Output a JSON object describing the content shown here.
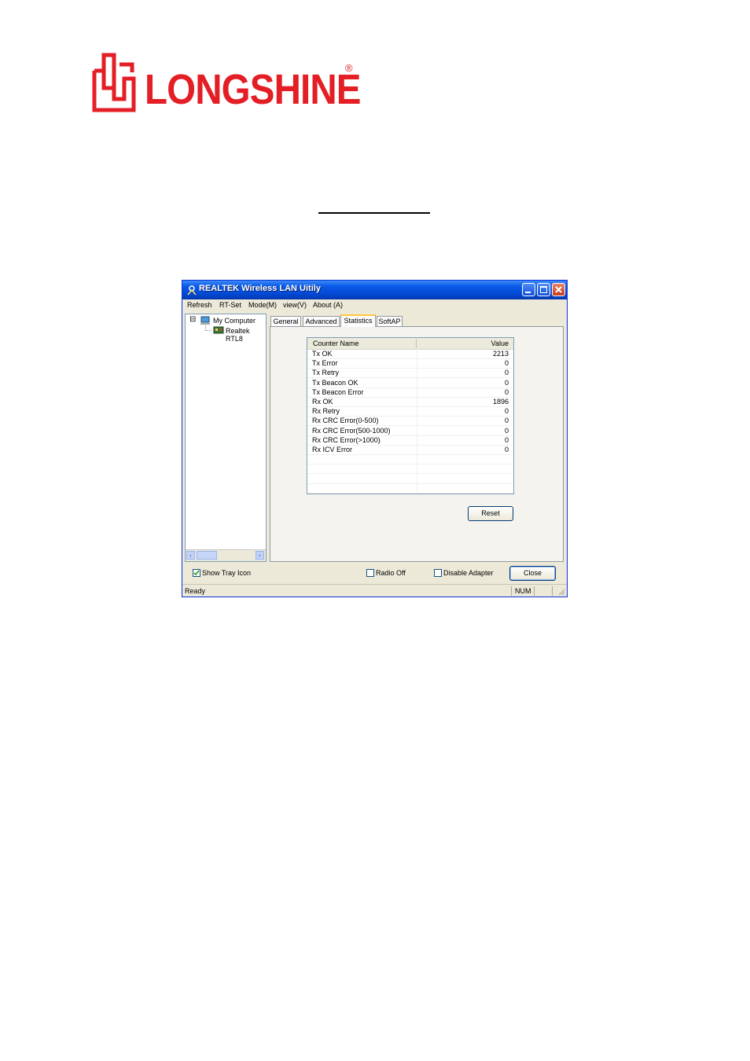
{
  "logo": {
    "brand": "LONGSHINE",
    "registered": "®"
  },
  "window": {
    "title": "REALTEK Wireless LAN Uitily"
  },
  "menu": [
    "Refresh",
    "RT-Set",
    "Mode(M)",
    "view(V)",
    "About (A)"
  ],
  "tree": {
    "toggle": "⊟",
    "root": "My Computer",
    "child": "Realtek RTL8"
  },
  "tabs": [
    "General",
    "Advanced",
    "Statistics",
    "SoftAP"
  ],
  "active_tab": "Statistics",
  "statistics": {
    "headers": {
      "name": "Counter Name",
      "value": "Value"
    },
    "rows": [
      {
        "name": "Tx OK",
        "value": "2213"
      },
      {
        "name": "Tx Error",
        "value": "0"
      },
      {
        "name": "Tx Retry",
        "value": "0"
      },
      {
        "name": "Tx Beacon OK",
        "value": "0"
      },
      {
        "name": "Tx Beacon Error",
        "value": "0"
      },
      {
        "name": "Rx OK",
        "value": "1896"
      },
      {
        "name": "Rx Retry",
        "value": "0"
      },
      {
        "name": "Rx CRC Error(0-500)",
        "value": "0"
      },
      {
        "name": "Rx CRC Error(500-1000)",
        "value": "0"
      },
      {
        "name": "Rx CRC Error(>1000)",
        "value": "0"
      },
      {
        "name": "Rx ICV Error",
        "value": "0"
      }
    ],
    "reset_label": "Reset"
  },
  "bottom": {
    "show_tray_icon": {
      "label": "Show Tray Icon",
      "checked": true
    },
    "radio_off": {
      "label": "Radio Off",
      "checked": false
    },
    "disable_adapter": {
      "label": "Disable Adapter",
      "checked": false
    },
    "close_label": "Close"
  },
  "status": {
    "text": "Ready",
    "num": "NUM"
  },
  "colors": {
    "brand_red": "#e31e24",
    "title_blue": "#0a5ae8"
  }
}
